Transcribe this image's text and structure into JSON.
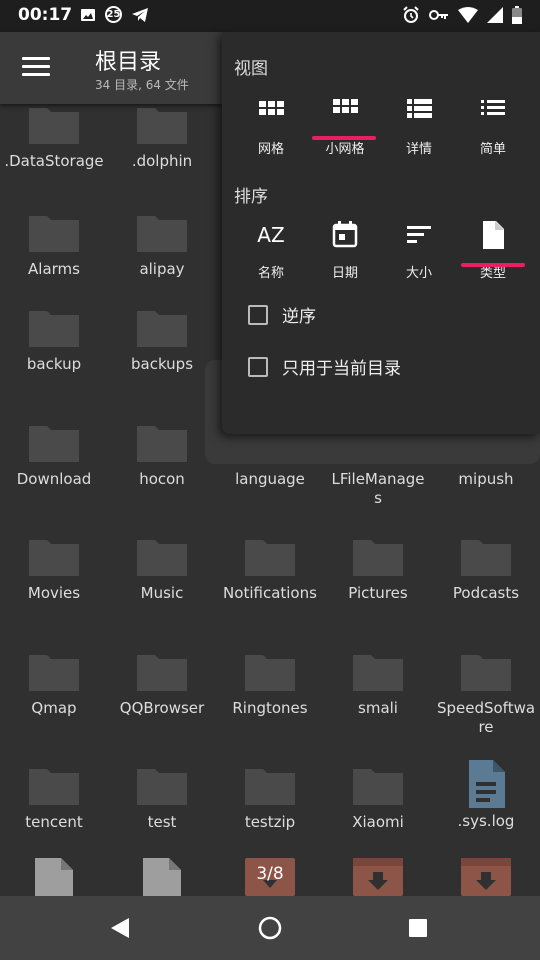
{
  "status": {
    "time": "00:17",
    "badge": "25"
  },
  "appbar": {
    "title": "根目录",
    "subtitle": "34 目录, 64 文件"
  },
  "popup": {
    "view_header": "视图",
    "view_options": [
      {
        "label": "网格"
      },
      {
        "label": "小网格"
      },
      {
        "label": "详情"
      },
      {
        "label": "简单"
      }
    ],
    "view_selected": "小网格",
    "sort_header": "排序",
    "sort_options": [
      {
        "label": "名称",
        "icon_text": "AZ"
      },
      {
        "label": "日期"
      },
      {
        "label": "大小"
      },
      {
        "label": "类型"
      }
    ],
    "sort_selected": "类型",
    "reverse_label": "逆序",
    "current_dir_label": "只用于当前目录"
  },
  "files": [
    {
      "name": ".DataStorage"
    },
    {
      "name": ".dolphin"
    },
    {
      "name": "Alarms"
    },
    {
      "name": "alipay"
    },
    {
      "name": "backup"
    },
    {
      "name": "backups"
    },
    {
      "name": "Download"
    },
    {
      "name": "hocon"
    },
    {
      "name": "language"
    },
    {
      "name": "LFileManages"
    },
    {
      "name": "mipush"
    },
    {
      "name": "Movies"
    },
    {
      "name": "Music"
    },
    {
      "name": "Notifications"
    },
    {
      "name": "Pictures"
    },
    {
      "name": "Podcasts"
    },
    {
      "name": "Qmap"
    },
    {
      "name": "QQBrowser"
    },
    {
      "name": "Ringtones"
    },
    {
      "name": "smali"
    },
    {
      "name": "SpeedSoftware"
    },
    {
      "name": "tencent"
    },
    {
      "name": "test"
    },
    {
      "name": "testzip"
    },
    {
      "name": "Xiaomi"
    },
    {
      "name": ".sys.log"
    }
  ],
  "bottom_row": [
    {
      "kind": "file"
    },
    {
      "kind": "file"
    },
    {
      "kind": "archive",
      "label": "3/8"
    },
    {
      "kind": "archive"
    },
    {
      "kind": "archive"
    }
  ],
  "colors": {
    "accent": "#e91e63",
    "folder": "#4a4a4a",
    "file_blue": "#5b7a93"
  }
}
